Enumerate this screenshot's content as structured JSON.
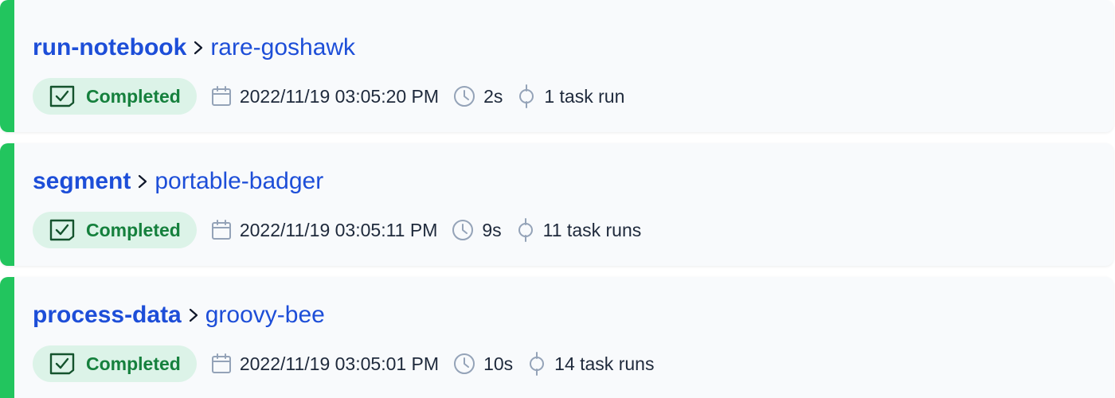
{
  "runs": [
    {
      "flow_name": "run-notebook",
      "run_name": "rare-goshawk",
      "state": "Completed",
      "start_time": "2022/11/19 03:05:20 PM",
      "duration": "2s",
      "task_runs": "1 task run"
    },
    {
      "flow_name": "segment",
      "run_name": "portable-badger",
      "state": "Completed",
      "start_time": "2022/11/19 03:05:11 PM",
      "duration": "9s",
      "task_runs": "11 task runs"
    },
    {
      "flow_name": "process-data",
      "run_name": "groovy-bee",
      "state": "Completed",
      "start_time": "2022/11/19 03:05:01 PM",
      "duration": "10s",
      "task_runs": "14 task runs"
    }
  ],
  "icons": {
    "separator": "chevron-right-icon",
    "state": "checkbox-checked-icon",
    "start_time": "calendar-icon",
    "duration": "clock-icon",
    "task_runs": "task-run-icon"
  },
  "colors": {
    "completed_accent": "#22c55e",
    "completed_text": "#15803d",
    "completed_badge_bg": "#dcf3e8",
    "link_blue": "#1d4ed8",
    "icon_gray": "#94a3b8",
    "card_bg": "#f8fafc"
  }
}
